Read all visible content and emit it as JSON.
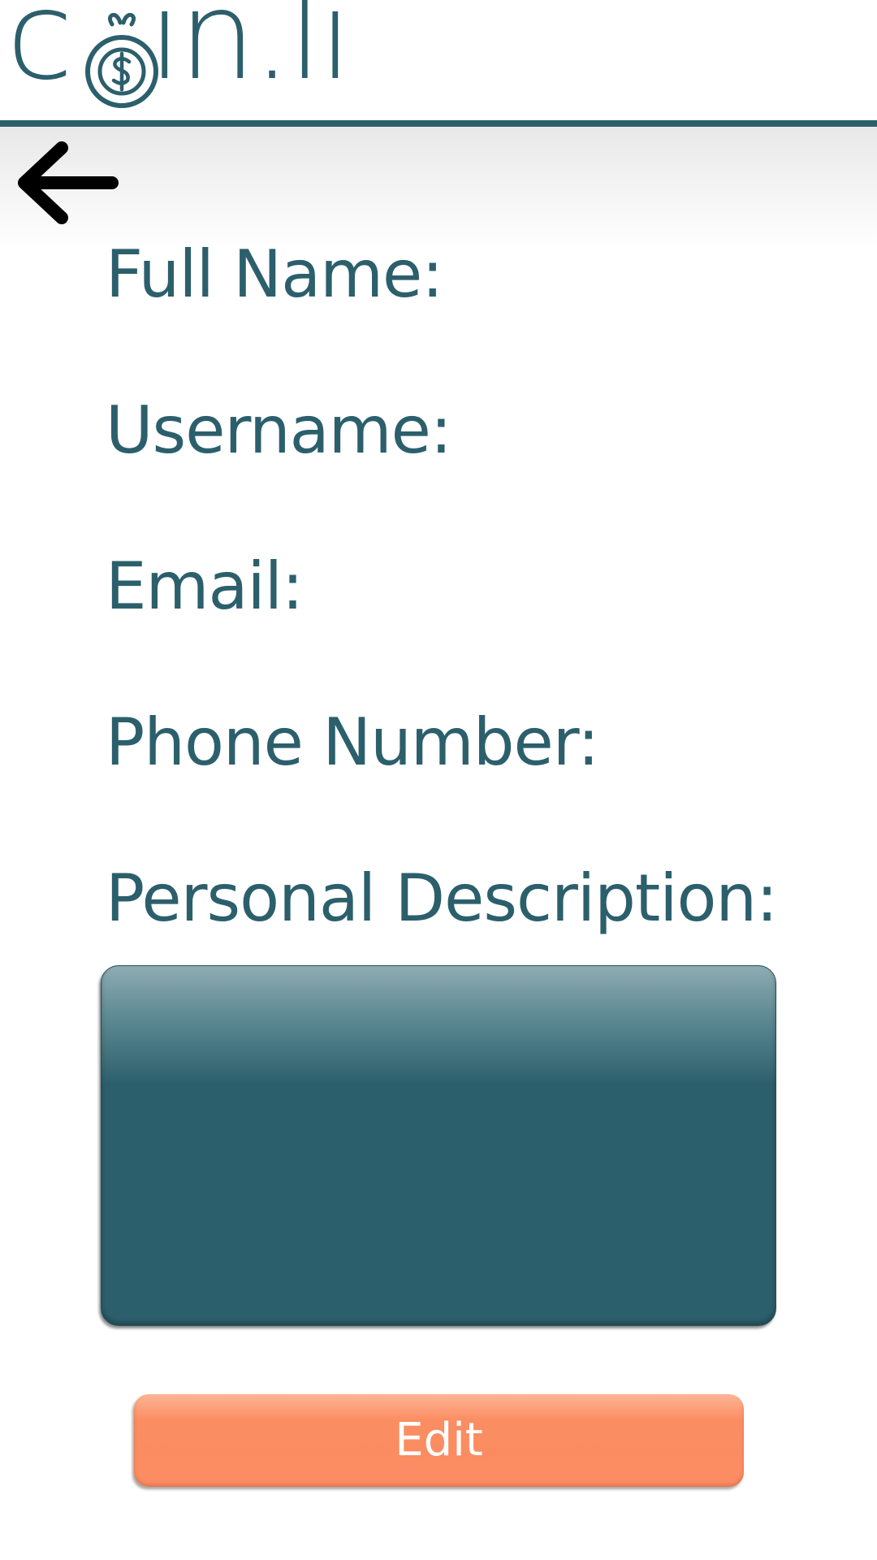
{
  "app": {
    "logo_text_left": "c",
    "logo_text_right": "in.li",
    "brand_color": "#2c5f6c",
    "accent_color": "#fb8c63"
  },
  "nav": {
    "back_icon": "arrow-left-icon"
  },
  "profile": {
    "full_name_label": "Full Name:",
    "username_label": "Username:",
    "email_label": "Email:",
    "phone_label": "Phone Number:",
    "description_label": "Personal Description:",
    "description_value": ""
  },
  "actions": {
    "edit_label": "Edit"
  }
}
